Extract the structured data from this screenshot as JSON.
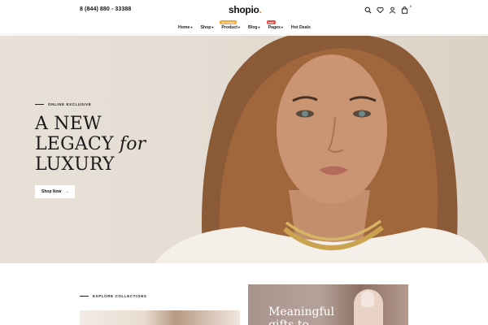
{
  "header": {
    "phone": "8 (844) 880 - 33388",
    "logo": "shopio",
    "logo_dot": ".",
    "cart_count": "0"
  },
  "nav": {
    "items": [
      {
        "label": "Home",
        "caret": "▾",
        "badge": ""
      },
      {
        "label": "Shop",
        "caret": "▾",
        "badge": ""
      },
      {
        "label": "Product",
        "caret": "▾",
        "badge": "FEATURED",
        "badge_color": "#f2a93b"
      },
      {
        "label": "Blog",
        "caret": "▾",
        "badge": ""
      },
      {
        "label": "Pages",
        "caret": "▾",
        "badge": "NEW",
        "badge_color": "#e74c3c"
      },
      {
        "label": "Hot Deals",
        "caret": "",
        "badge": ""
      }
    ]
  },
  "hero": {
    "eyebrow": "ONLINE EXCLUSIVE",
    "headline_1": "A NEW",
    "headline_2a": "LEGACY ",
    "headline_2b": "for",
    "headline_3": "LUXURY",
    "button_label": "Shop Now",
    "button_arrow": "→"
  },
  "collections": {
    "eyebrow": "EXPLORE COLLECTIONS"
  },
  "gift": {
    "title_line_1": "Meaningful",
    "title_line_2": "gifts to"
  },
  "icons": [
    "search-icon",
    "heart-icon",
    "user-icon",
    "cart-icon"
  ],
  "colors": {
    "accent": "#e0833a",
    "featured_badge": "#f2a93b",
    "new_badge": "#e74c3c"
  }
}
